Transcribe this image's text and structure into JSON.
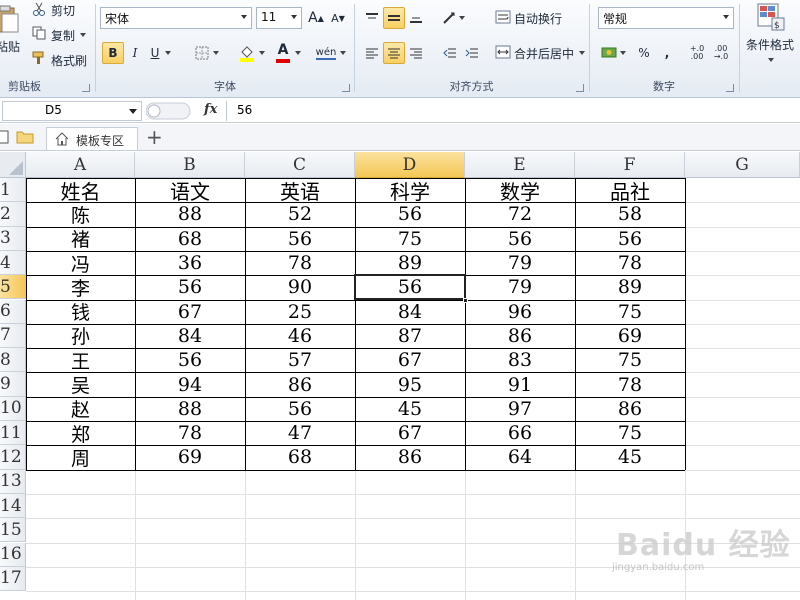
{
  "ribbon": {
    "clipboard": {
      "paste_label": "粘贴",
      "cut_label": "剪切",
      "copy_label": "复制",
      "format_painter_label": "格式刷",
      "group_title": "剪贴板"
    },
    "font": {
      "font_name": "宋体",
      "font_size": "11",
      "bold": "B",
      "italic": "I",
      "underline": "U",
      "grow_font": "A",
      "shrink_font": "A",
      "font_color": "A",
      "phonetic": "wén",
      "group_title": "字体",
      "fill_color": "#ffff00",
      "text_color": "#e00000"
    },
    "alignment": {
      "wrap_text_label": "自动换行",
      "merge_center_label": "合并后居中",
      "group_title": "对齐方式"
    },
    "number": {
      "format_value": "常规",
      "percent": "%",
      "comma": ",",
      "inc_decimal": "+.0 .00",
      "dec_decimal": ".00 →.0",
      "group_title": "数字"
    },
    "styles": {
      "conditional_format_label": "条件格式"
    }
  },
  "formula_bar": {
    "name_box": "D5",
    "fx": "fx",
    "formula": "56"
  },
  "tab_bar": {
    "template_tab": "模板专区",
    "add_tab": "+"
  },
  "sheet": {
    "columns": [
      "A",
      "B",
      "C",
      "D",
      "E",
      "F",
      "G"
    ],
    "rows": [
      "1",
      "2",
      "3",
      "4",
      "5",
      "6",
      "7",
      "8",
      "9",
      "10",
      "11",
      "12",
      "13",
      "14",
      "15",
      "16",
      "17"
    ],
    "selected_column": "D",
    "selected_row": "5",
    "header": [
      "姓名",
      "语文",
      "英语",
      "科学",
      "数学",
      "品社"
    ],
    "data": [
      [
        "陈",
        "88",
        "52",
        "56",
        "72",
        "58"
      ],
      [
        "褚",
        "68",
        "56",
        "75",
        "56",
        "56"
      ],
      [
        "冯",
        "36",
        "78",
        "89",
        "79",
        "78"
      ],
      [
        "李",
        "56",
        "90",
        "56",
        "79",
        "89"
      ],
      [
        "钱",
        "67",
        "25",
        "84",
        "96",
        "75"
      ],
      [
        "孙",
        "84",
        "46",
        "87",
        "86",
        "69"
      ],
      [
        "王",
        "56",
        "57",
        "67",
        "83",
        "75"
      ],
      [
        "吴",
        "94",
        "86",
        "95",
        "91",
        "78"
      ],
      [
        "赵",
        "88",
        "56",
        "45",
        "97",
        "86"
      ],
      [
        "郑",
        "78",
        "47",
        "67",
        "66",
        "75"
      ],
      [
        "周",
        "69",
        "68",
        "86",
        "64",
        "45"
      ]
    ]
  },
  "watermark": {
    "brand": "Baidu 经验",
    "url": "jingyan.baidu.com"
  },
  "colors": {
    "selection_accent": "#f4c757",
    "ribbon_bg": "#e5ebf3"
  }
}
